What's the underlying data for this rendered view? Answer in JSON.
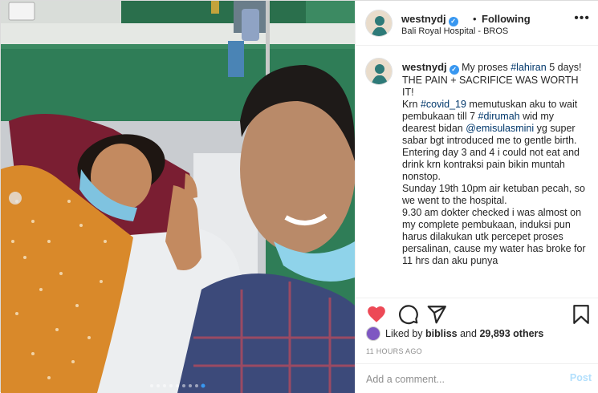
{
  "header": {
    "username": "westnydj",
    "verified_mark": "✓",
    "separator": "•",
    "follow_status": "Following",
    "location": "Bali Royal Hospital - BROS",
    "more_icon": "more-horizontal-icon"
  },
  "photo": {
    "description_icon": "post-photo"
  },
  "caption": {
    "username": "westnydj",
    "verified_mark": "✓",
    "intro": " My proses ",
    "hashtag_lahiran": "#lahiran",
    "intro_end": " 5 days!",
    "line2": "THE PAIN + SACRIFICE WAS WORTH IT!",
    "krn": "Krn ",
    "hashtag_covid": "#covid_19",
    "p3a": " memutuskan aku to wait pembukaan till 7 ",
    "hashtag_dirumah": "#dirumah",
    "p3b": " wid my dearest bidan ",
    "mention": "@emisulasmini",
    "p3c": " yg super sabar bgt introduced me to gentle birth.",
    "p4": "Entering day 3 and 4 i could not eat and drink krn kontraksi pain bikin muntah nonstop.",
    "p5": "Sunday 19th 10pm air ketuban pecah, so we went to the hospital.",
    "p6": "9.30 am dokter checked i was almost on my complete pembukaan, induksi pun harus dilakukan utk percepet proses persalinan, cause my water has broke for 11 hrs dan aku punya"
  },
  "actions": {
    "heart_icon": "heart-icon",
    "comment_icon": "comment-icon",
    "share_icon": "share-icon",
    "save_icon": "bookmark-icon"
  },
  "likes": {
    "prefix": "Liked by ",
    "user": "bibliss",
    "middle": " and ",
    "count": "29,893 others"
  },
  "timestamp": "11 HOURS AGO",
  "comment": {
    "placeholder": "Add a comment...",
    "post_label": "Post"
  },
  "colors": {
    "heart": "#ed4956",
    "link": "#00376b",
    "verified": "#3897f0",
    "post_disabled": "#b2dffc"
  }
}
